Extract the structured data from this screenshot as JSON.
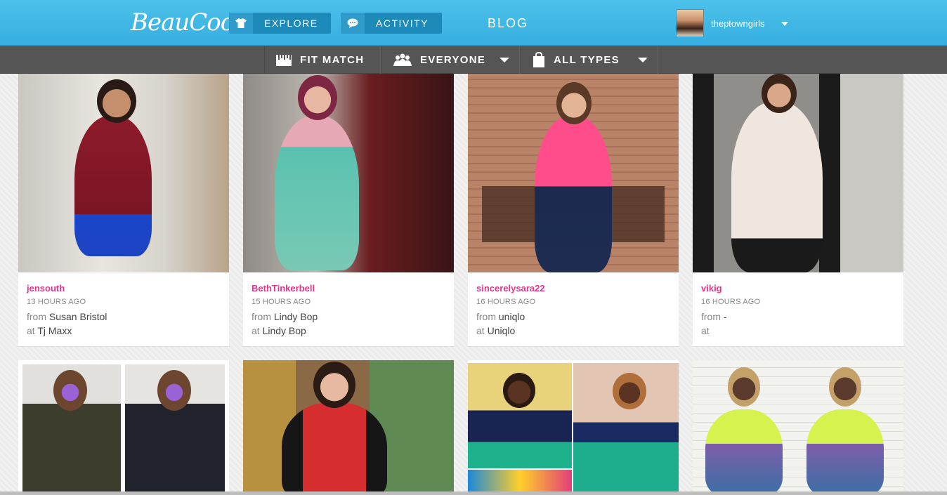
{
  "header": {
    "logo": "BeauCoo",
    "nav": {
      "explore": "EXPLORE",
      "activity": "ACTIVITY",
      "blog": "BLOG"
    },
    "user": {
      "name": "theptowngirls"
    }
  },
  "filters": {
    "fit_match": "FIT MATCH",
    "everyone": "EVERYONE",
    "all_types": "ALL TYPES"
  },
  "posts": [
    {
      "user": "jensouth",
      "time": "13 HOURS AGO",
      "from_label": "from",
      "from": "Susan Bristol",
      "at_label": "at",
      "at": "Tj Maxx"
    },
    {
      "user": "BethTinkerbell",
      "time": "15 HOURS AGO",
      "from_label": "from",
      "from": "Lindy Bop",
      "at_label": "at",
      "at": "Lindy Bop"
    },
    {
      "user": "sincerelysara22",
      "time": "16 HOURS AGO",
      "from_label": "from",
      "from": "uniqlo",
      "at_label": "at",
      "at": "Uniqlo"
    },
    {
      "user": "vikig",
      "time": "16 HOURS AGO",
      "from_label": "from",
      "from": "-",
      "at_label": "at",
      "at": ""
    }
  ],
  "colors": {
    "header_blue": "#4cc1ea",
    "nav_button": "#1e8ab9",
    "filter_bar": "#555555",
    "username_pink": "#e3358c"
  },
  "icons": [
    "shirt-icon",
    "speech-bubble-icon",
    "ruler-icon",
    "people-icon",
    "shopping-bag-icon",
    "caret-down-icon"
  ]
}
